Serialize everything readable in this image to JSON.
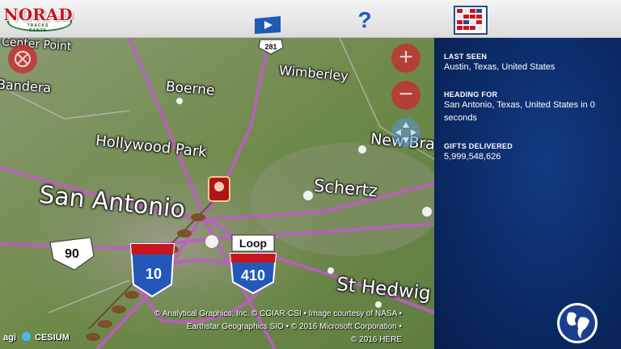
{
  "header": {
    "logo_text": "NORAD",
    "logo_subtext": "TRACKS SANTA",
    "video_icon": "video-play-icon",
    "help_label": "?",
    "game_icon": "games-grid-icon"
  },
  "map": {
    "places": [
      {
        "name": "Center Point"
      },
      {
        "name": "Bandera"
      },
      {
        "name": "Boerne"
      },
      {
        "name": "Wimberley"
      },
      {
        "name": "Hollywood Park"
      },
      {
        "name": "New Braunfels"
      },
      {
        "name": "Schertz"
      },
      {
        "name": "San Antonio"
      },
      {
        "name": "St Hedwig"
      }
    ],
    "shields": {
      "us281": "281",
      "i90": "90",
      "loop": "Loop",
      "i410": "410",
      "i10": "10"
    },
    "controls": {
      "zoom_in": "+",
      "zoom_out": "−"
    },
    "attribution": [
      "© Analytical Graphics, Inc. © CGIAR-CSI • Image courtesy of NASA •",
      "Earthstar Geographics SIO • © 2016 Microsoft Corporation •",
      "© 2016 HERE"
    ],
    "agi_label": "agi",
    "cesium_label": "CESIUM"
  },
  "info": {
    "last_seen_label": "LAST SEEN",
    "last_seen_value": "Austin, Texas, United States",
    "heading_label": "HEADING FOR",
    "heading_value": "San Antonio, Texas, United States in 0 seconds",
    "gifts_label": "GIFTS DELIVERED",
    "gifts_value": "5,999,548,626"
  },
  "colors": {
    "panel": "#0c2a5e",
    "accent_red": "#c7161d",
    "accent_blue": "#1e5bb5",
    "road": "#c05bc8"
  }
}
